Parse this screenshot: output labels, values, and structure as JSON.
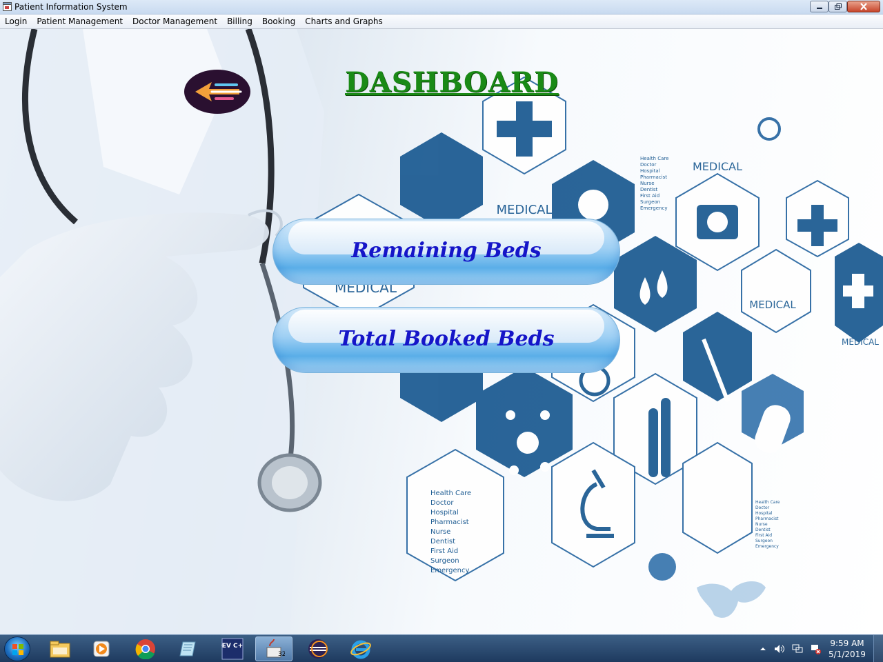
{
  "window": {
    "title": "Patient Information System",
    "icon": "app-window-icon",
    "controls": [
      "minimize-icon",
      "maximize-icon",
      "close-icon"
    ]
  },
  "menu": {
    "items": [
      {
        "label": "Login"
      },
      {
        "label": "Patient Management"
      },
      {
        "label": "Doctor Management"
      },
      {
        "label": "Billing"
      },
      {
        "label": "Booking"
      },
      {
        "label": "Charts and Graphs"
      }
    ]
  },
  "dashboard": {
    "title": "DASHBOARD",
    "title_color": "#1a8a16",
    "back_icon": "back-arrow-icon",
    "buttons": {
      "remaining_beds": "Remaining Beds",
      "total_booked_beds": "Total Booked Beds"
    },
    "button_text_color": "#1515c8"
  },
  "background": {
    "hex_labels": [
      "MEDICAL",
      "MEDICAL",
      "MEDICAL",
      "MEDICAL",
      "MEDICAL"
    ],
    "hex_list": [
      "Health Care",
      "Doctor",
      "Hospital",
      "Pharmacist",
      "Nurse",
      "Dentist",
      "First Aid",
      "Surgeon",
      "Emergency"
    ]
  },
  "taskbar": {
    "start": "windows-start-icon",
    "apps": [
      "file-explorer-icon",
      "media-player-icon",
      "chrome-icon",
      "notepad-icon",
      "devcpp-icon",
      "java-app-icon",
      "eclipse-icon",
      "internet-explorer-icon"
    ],
    "devcpp_label": "DEV C++",
    "active_badge": "32",
    "tray_icons": [
      "tray-expand-icon",
      "volume-icon",
      "network-icon",
      "action-center-icon"
    ],
    "time": "9:59 AM",
    "date": "5/1/2019"
  }
}
